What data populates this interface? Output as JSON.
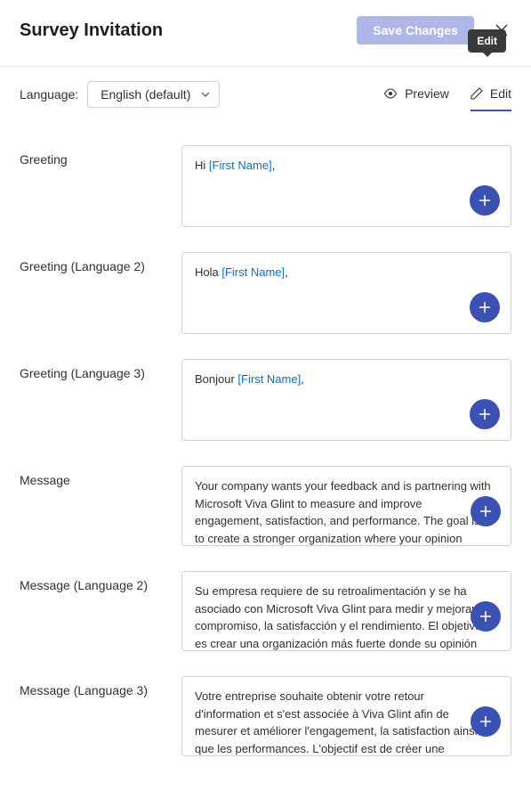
{
  "header": {
    "title": "Survey Invitation",
    "saveLabel": "Save Changes"
  },
  "toolbar": {
    "languageLabel": "Language:",
    "languageValue": "English (default)",
    "previewLabel": "Preview",
    "editLabel": "Edit",
    "tooltip": "Edit"
  },
  "fields": {
    "greeting": {
      "label": "Greeting",
      "prefix": "Hi ",
      "token": "[First Name]",
      "suffix": ","
    },
    "greeting2": {
      "label": "Greeting (Language 2)",
      "prefix": "Hola ",
      "token": "[First Name]",
      "suffix": ","
    },
    "greeting3": {
      "label": "Greeting (Language 3)",
      "prefix": "Bonjour ",
      "token": "[First Name]",
      "suffix": ","
    },
    "message": {
      "label": "Message",
      "text": "Your company wants your feedback and is partnering with Microsoft Viva Glint to measure and improve engagement, satisfaction, and performance. The goal is to create a stronger organization where your opinion matters."
    },
    "message2": {
      "label": "Message (Language 2)",
      "text": "Su empresa requiere de su retroalimentación y se ha asociado con Microsoft Viva Glint para medir y mejorar el compromiso, la satisfacción y el rendimiento. El objetivo es crear una organización más fuerte donde su opinión sea importante."
    },
    "message3": {
      "label": "Message (Language 3)",
      "text": "Votre entreprise souhaite obtenir votre retour d'information et s'est associée à Viva Glint afin de mesurer et améliorer l'engagement, la satisfaction ainsi que les performances. L'objectif est de créer une organisation plus forte où l'opinion de chacun est prise."
    }
  }
}
